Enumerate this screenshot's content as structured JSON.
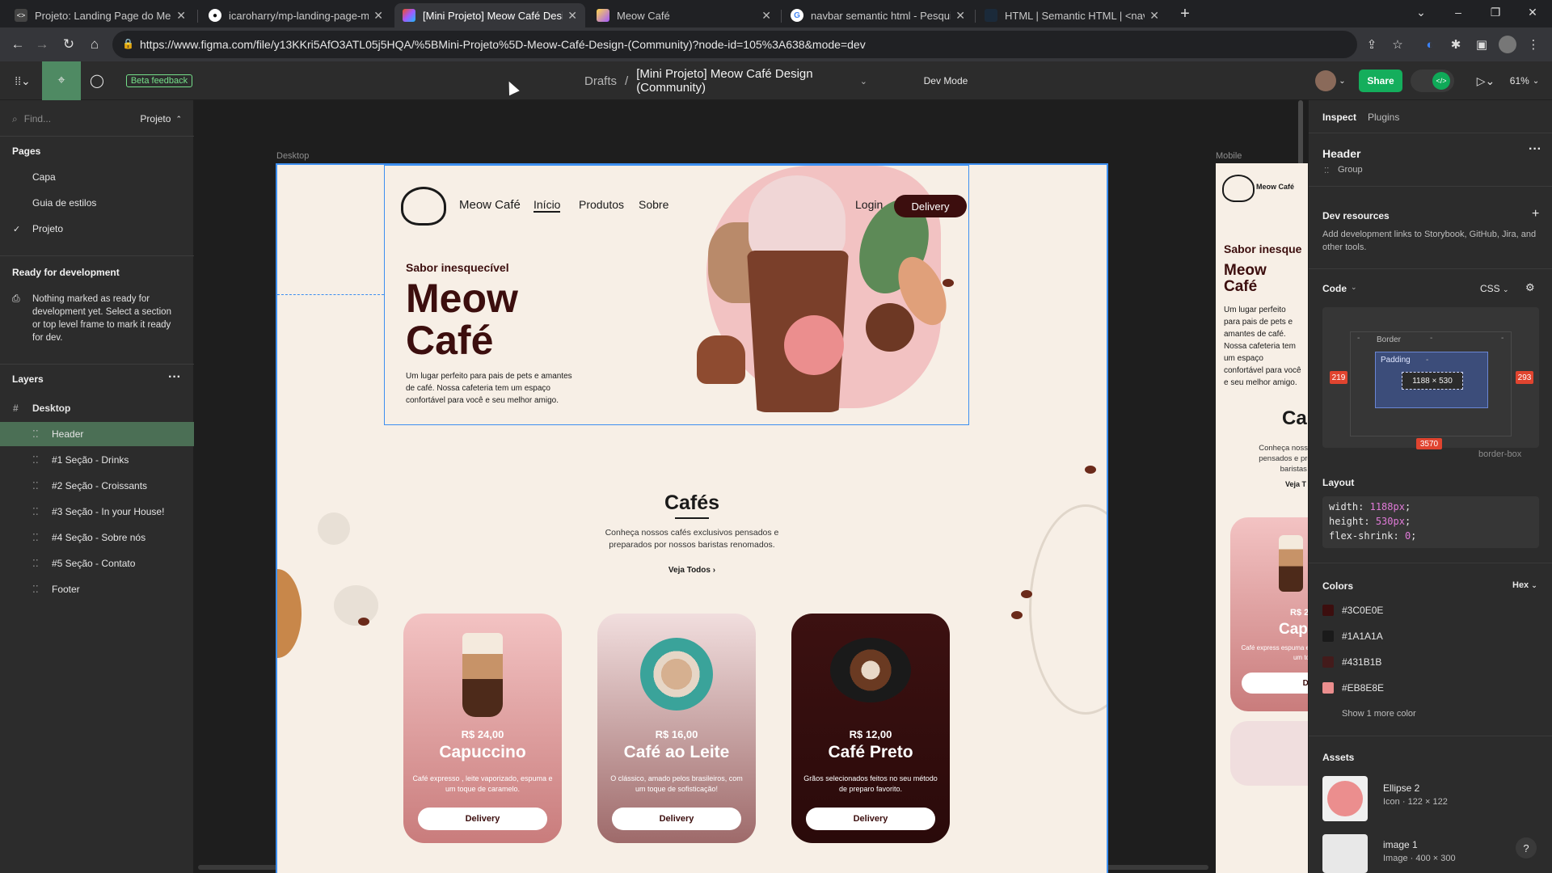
{
  "browser": {
    "tabs": [
      {
        "title": "Projeto: Landing Page do Meow",
        "active": false
      },
      {
        "title": "icaroharry/mp-landing-page-m",
        "active": false
      },
      {
        "title": "[Mini Projeto] Meow Café Design",
        "active": true
      },
      {
        "title": "Meow Café",
        "active": false
      },
      {
        "title": "navbar semantic html - Pesquisa",
        "active": false
      },
      {
        "title": "HTML | Semantic HTML | <nav>",
        "active": false
      }
    ],
    "url": "https://www.figma.com/file/y13KKri5AfO3ATL05j5HQA/%5BMini-Projeto%5D-Meow-Café-Design-(Community)?node-id=105%3A638&mode=dev"
  },
  "toolbar": {
    "beta_feedback": "Beta feedback",
    "breadcrumb_parent": "Drafts",
    "breadcrumb_sep": "/",
    "file_title": "[Mini Projeto] Meow Café Design (Community)",
    "dev_mode": "Dev Mode",
    "share": "Share",
    "zoom": "61%"
  },
  "left_panel": {
    "search_placeholder": "Find...",
    "page_selector": "Projeto",
    "pages_heading": "Pages",
    "pages": [
      "Capa",
      "Guia de estilos",
      "Projeto"
    ],
    "ready_heading": "Ready for development",
    "ready_text": "Nothing marked as ready for development yet. Select a section or top level frame to mark it ready for dev.",
    "layers_heading": "Layers",
    "layers": [
      "Desktop",
      "Header",
      "#1 Seção - Drinks",
      "#2 Seção - Croissants",
      "#3 Seção - In your House!",
      "#4 Seção - Sobre nós",
      "#5 Seção - Contato",
      "Footer"
    ]
  },
  "canvas": {
    "desktop_label": "Desktop",
    "mobile_label": "Mobile",
    "measure_left": "219",
    "measure_bottom": "3570",
    "design": {
      "brand": "Meow Café",
      "nav": [
        "Início",
        "Produtos",
        "Sobre"
      ],
      "login": "Login",
      "delivery": "Delivery",
      "eyebrow": "Sabor inesquecível",
      "hero_title_1": "Meow",
      "hero_title_2": "Café",
      "hero_text": "Um lugar perfeito para pais de pets e amantes de café. Nossa cafeteria tem um espaço confortável para você e seu melhor amigo.",
      "section_title": "Cafés",
      "section_text": "Conheça nossos cafés exclusivos pensados e preparados por nossos baristas renomados.",
      "see_all": "Veja Todos ›",
      "cards": [
        {
          "price": "R$ 24,00",
          "name": "Capuccino",
          "desc": "Café expresso , leite vaporizado, espuma e um toque de caramelo.",
          "button": "Delivery"
        },
        {
          "price": "R$ 16,00",
          "name": "Café ao Leite",
          "desc": "O clássico, amado pelos brasileiros, com um toque de sofisticação!",
          "button": "Delivery"
        },
        {
          "price": "R$ 12,00",
          "name": "Café Preto",
          "desc": "Grãos selecionados feitos no seu método de preparo favorito.",
          "button": "Delivery"
        }
      ]
    },
    "mobile": {
      "brand": "Meow Café",
      "eyebrow": "Sabor inesque",
      "title_1": "Meow",
      "title_2": "Café",
      "text": "Um lugar perfeito para pais de pets e amantes de café. Nossa cafeteria tem um espaço confortável para você e seu melhor amigo.",
      "section_title": "Ca",
      "section_text": "Conheça nossos pensados e prep baristas re",
      "see_all": "Veja T",
      "card_price": "R$ 2",
      "card_name": "Capu",
      "card_desc": "Café express espuma e um to",
      "card_button": "Deli"
    }
  },
  "right_panel": {
    "tabs": [
      "Inspect",
      "Plugins"
    ],
    "selection_name": "Header",
    "selection_type": "Group",
    "dev_resources_heading": "Dev resources",
    "dev_resources_text": "Add development links to Storybook, GitHub, Jira, and other tools.",
    "code_heading": "Code",
    "code_lang": "CSS",
    "box": {
      "border": "Border",
      "padding": "Padding",
      "size": "1188 × 530",
      "left": "219",
      "right": "293",
      "bottom": "3570",
      "dash": "-",
      "sizing": "border-box"
    },
    "layout_heading": "Layout",
    "layout_code": [
      {
        "prop": "width:",
        "val": "1188px",
        "end": ";"
      },
      {
        "prop": "height:",
        "val": "530px",
        "end": ";"
      },
      {
        "prop": "flex-shrink:",
        "val": "0",
        "end": ";"
      }
    ],
    "colors_heading": "Colors",
    "colors_format": "Hex",
    "colors": [
      {
        "hex": "#3C0E0E",
        "swatch": "#3C0E0E"
      },
      {
        "hex": "#1A1A1A",
        "swatch": "#1A1A1A"
      },
      {
        "hex": "#431B1B",
        "swatch": "#431B1B"
      },
      {
        "hex": "#EB8E8E",
        "swatch": "#EB8E8E"
      }
    ],
    "more_colors": "Show 1 more color",
    "assets_heading": "Assets",
    "assets": [
      {
        "name": "Ellipse 2",
        "meta": "Icon · 122 × 122"
      },
      {
        "name": "image 1",
        "meta": "Image · 400 × 300"
      }
    ]
  }
}
